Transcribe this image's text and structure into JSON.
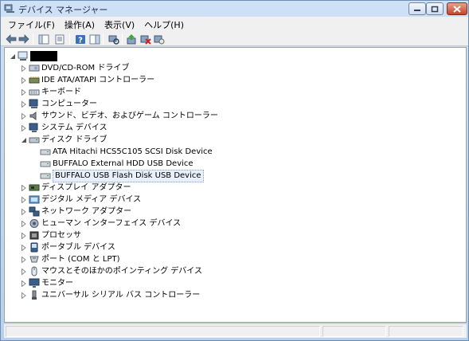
{
  "window": {
    "title": "デバイス マネージャー",
    "colors": {
      "titlebar": "#cfe1f5",
      "close": "#c5442a",
      "selection": "#e8f1fb"
    }
  },
  "menu": [
    "ファイル(F)",
    "操作(A)",
    "表示(V)",
    "ヘルプ(H)"
  ],
  "toolbar": {
    "icons": [
      "back-arrow-icon",
      "forward-arrow-icon",
      "show-hide-console-tree-icon",
      "properties-icon",
      "help-icon",
      "action-pane-icon",
      "scan-hardware-icon",
      "update-driver-icon",
      "disable-device-icon",
      "uninstall-device-icon"
    ]
  },
  "tree": {
    "root_label": "",
    "categories": [
      {
        "label": "DVD/CD-ROM ドライブ",
        "icon": "dvd-drive-icon",
        "expanded": false
      },
      {
        "label": "IDE ATA/ATAPI コントローラー",
        "icon": "ide-controller-icon",
        "expanded": false
      },
      {
        "label": "キーボード",
        "icon": "keyboard-icon",
        "expanded": false
      },
      {
        "label": "コンピューター",
        "icon": "computer-icon",
        "expanded": false
      },
      {
        "label": "サウンド、ビデオ、およびゲーム コントローラー",
        "icon": "sound-icon",
        "expanded": false
      },
      {
        "label": "システム デバイス",
        "icon": "system-device-icon",
        "expanded": false
      },
      {
        "label": "ディスク ドライブ",
        "icon": "disk-drive-icon",
        "expanded": true,
        "children": [
          {
            "label": "ATA Hitachi HCS5C105 SCSI Disk Device",
            "icon": "disk-icon"
          },
          {
            "label": "BUFFALO External HDD USB Device",
            "icon": "disk-icon"
          },
          {
            "label": "BUFFALO USB Flash Disk USB Device",
            "icon": "disk-icon",
            "selected": true
          }
        ]
      },
      {
        "label": "ディスプレイ アダプター",
        "icon": "display-adapter-icon",
        "expanded": false
      },
      {
        "label": "デジタル メディア デバイス",
        "icon": "digital-media-icon",
        "expanded": false
      },
      {
        "label": "ネットワーク アダプター",
        "icon": "network-adapter-icon",
        "expanded": false
      },
      {
        "label": "ヒューマン インターフェイス デバイス",
        "icon": "hid-icon",
        "expanded": false
      },
      {
        "label": "プロセッサ",
        "icon": "processor-icon",
        "expanded": false
      },
      {
        "label": "ポータブル デバイス",
        "icon": "portable-device-icon",
        "expanded": false
      },
      {
        "label": "ポート (COM と LPT)",
        "icon": "port-icon",
        "expanded": false
      },
      {
        "label": "マウスとそのほかのポインティング デバイス",
        "icon": "mouse-icon",
        "expanded": false
      },
      {
        "label": "モニター",
        "icon": "monitor-icon",
        "expanded": false
      },
      {
        "label": "ユニバーサル シリアル バス コントローラー",
        "icon": "usb-controller-icon",
        "expanded": false
      }
    ]
  }
}
